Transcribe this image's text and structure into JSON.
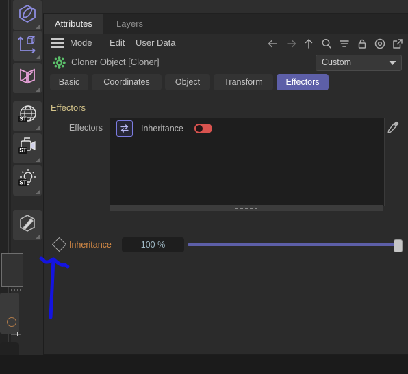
{
  "app": {
    "theme_bg": "#2b2b2b",
    "accent": "#5d5fa8",
    "toggle_color": "#d9534f",
    "section_header_color": "#d4c48a",
    "param_label_color": "#d98c46"
  },
  "left_toolbar": {
    "items": [
      {
        "name": "spline-primitive-icon",
        "label": "Spline Primitive",
        "color": "#8d8ce0"
      },
      {
        "name": "axis-cube-icon",
        "label": "Modeling Axis / Cube",
        "color": "#8d8ce0"
      },
      {
        "name": "deformer-icon",
        "label": "Deformer",
        "color": "#e6a0d8"
      },
      {
        "name": "environment-globe-icon",
        "label": "Environment",
        "color": "#e3e3e3",
        "badge": "ST"
      },
      {
        "name": "camera-icon",
        "label": "Camera",
        "color": "#e3e3e3",
        "badge": "ST"
      },
      {
        "name": "light-icon",
        "label": "Light",
        "color": "#e3e3e3",
        "badge": "ST"
      },
      {
        "name": "sculpt-pencil-icon",
        "label": "Sculpting",
        "color": "#b9b9b9"
      }
    ]
  },
  "attributes_manager": {
    "tabs": [
      {
        "label": "Attributes",
        "active": true
      },
      {
        "label": "Layers",
        "active": false
      }
    ],
    "menu": {
      "burger": "menu-icon",
      "items": [
        "Mode",
        "Edit",
        "User Data"
      ]
    },
    "tool_icons": [
      "back-arrow-icon",
      "forward-arrow-icon",
      "up-arrow-icon",
      "search-icon",
      "filter-icon",
      "lock-icon",
      "target-icon",
      "open-external-icon"
    ],
    "object": {
      "icon": "cloner-object-icon",
      "name": "Cloner Object [Cloner]",
      "layout_dropdown": {
        "value": "Custom",
        "arrow": "chevron-down-icon"
      }
    },
    "sub_tabs": [
      {
        "label": "Basic",
        "active": false
      },
      {
        "label": "Coordinates",
        "active": false
      },
      {
        "label": "Object",
        "active": false
      },
      {
        "label": "Transform",
        "active": false
      },
      {
        "label": "Effectors",
        "active": true
      }
    ],
    "section": {
      "title": "Effectors",
      "field_label": "Effectors",
      "eyedropper": "eyedropper-icon",
      "list": [
        {
          "icon": "inheritance-effector-icon",
          "label": "Inheritance",
          "enabled_toggle": "on",
          "toggle_color": "#d9534f"
        }
      ],
      "resize_grip": "resize-grip"
    },
    "parameter": {
      "keyframe_icon": "keyframe-diamond-icon",
      "label": "Inheritance",
      "value": "100 %",
      "slider_percent": 100
    }
  },
  "annotation": {
    "type": "hand-drawn-arrow",
    "color": "#1414e0",
    "points": "pointing up at the Inheritance parameter row"
  }
}
